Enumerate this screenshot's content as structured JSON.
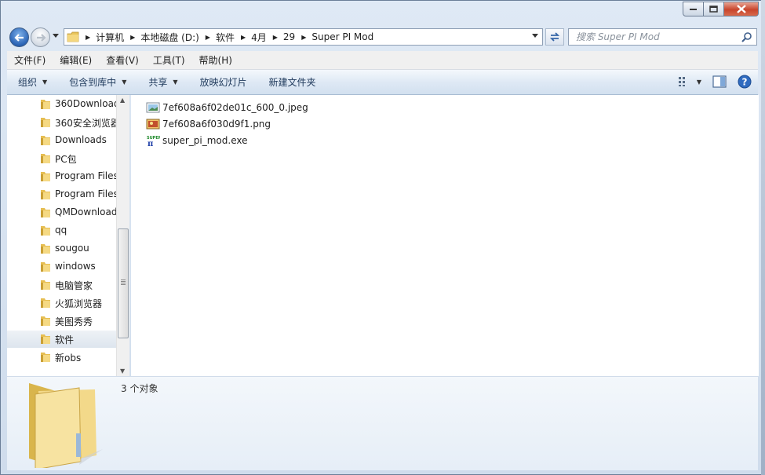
{
  "navigation": {
    "breadcrumb": [
      {
        "label": "计算机"
      },
      {
        "label": "本地磁盘 (D:)"
      },
      {
        "label": "软件"
      },
      {
        "label": "4月"
      },
      {
        "label": "29"
      },
      {
        "label": "Super PI Mod"
      }
    ],
    "search_placeholder": "搜索 Super PI Mod"
  },
  "menu": {
    "file": "文件(F)",
    "edit": "编辑(E)",
    "view": "查看(V)",
    "tools": "工具(T)",
    "help": "帮助(H)"
  },
  "toolbar": {
    "organize": "组织",
    "include_in_library": "包含到库中",
    "share": "共享",
    "slideshow": "放映幻灯片",
    "new_folder": "新建文件夹"
  },
  "nav_pane": {
    "items": [
      {
        "label": "360Download"
      },
      {
        "label": "360安全浏览器"
      },
      {
        "label": "Downloads"
      },
      {
        "label": "PC包"
      },
      {
        "label": "Program Files"
      },
      {
        "label": "Program Files"
      },
      {
        "label": "QMDownload"
      },
      {
        "label": "qq"
      },
      {
        "label": "sougou"
      },
      {
        "label": "windows"
      },
      {
        "label": "电脑管家"
      },
      {
        "label": "火狐浏览器"
      },
      {
        "label": "美图秀秀"
      },
      {
        "label": "软件",
        "selected": true
      },
      {
        "label": "新obs"
      }
    ]
  },
  "files": [
    {
      "name": "7ef608a6f02de01c_600_0.jpeg",
      "icon": "jpeg-image-icon"
    },
    {
      "name": "7ef608a6f030d9f1.png",
      "icon": "png-image-icon"
    },
    {
      "name": "super_pi_mod.exe",
      "icon": "super-pi-exe-icon"
    }
  ],
  "details": {
    "item_count": "3 个对象"
  },
  "colors": {
    "window_frame": "#dfe9f5",
    "selected_item": "#dde5ee",
    "close_button": "#c8452c",
    "folder": "#f2d27a"
  }
}
